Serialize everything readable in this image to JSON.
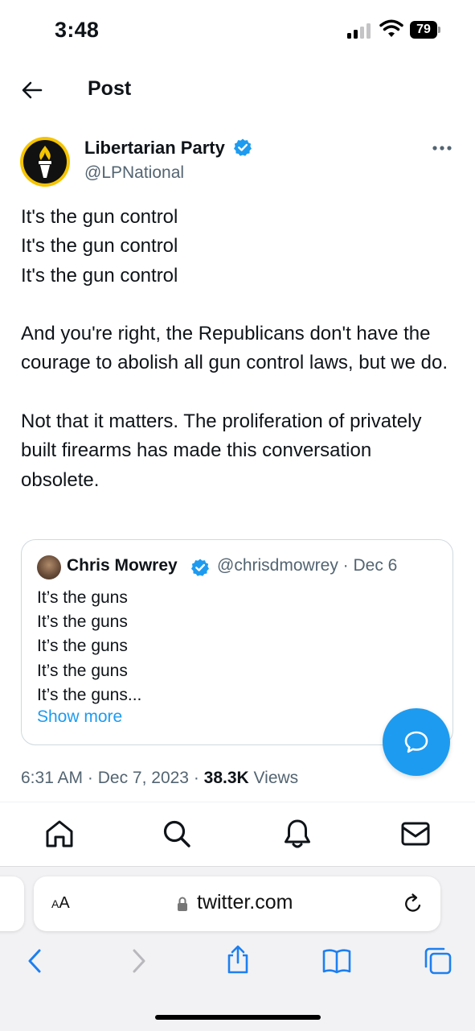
{
  "status_bar": {
    "time": "3:48",
    "battery": "79"
  },
  "header": {
    "title": "Post"
  },
  "post": {
    "author_name": "Libertarian Party",
    "author_handle": "@LPNational",
    "text": "It's the gun control\nIt's the gun control\nIt's the gun control\n\nAnd you're right, the Republicans don't have the courage to abolish all gun control laws, but we do.\n\nNot that it matters. The proliferation of privately built firearms has made this conversation obsolete.",
    "time": "6:31 AM",
    "date": "Dec 7, 2023",
    "views_count": "38.3K",
    "views_label": "Views"
  },
  "quote": {
    "author_name": "Chris Mowrey",
    "author_handle": "@chrisdmowrey · Dec 6",
    "text": "It’s the guns\nIt’s the guns\nIt’s the guns\nIt’s the guns\nIt’s the guns...",
    "show_more": "Show more"
  },
  "browser": {
    "font_size_label_small": "A",
    "font_size_label_large": "A",
    "domain": "twitter.com"
  },
  "colors": {
    "accent": "#1d9bf0",
    "secondary_text": "#536471",
    "avatar_ring": "#f5c400"
  },
  "icons": [
    "back-arrow-icon",
    "verified-badge-icon",
    "more-icon",
    "compose-reply-icon",
    "home-icon",
    "search-icon",
    "notifications-icon",
    "messages-icon",
    "lock-icon",
    "reload-icon",
    "browser-back-icon",
    "browser-forward-icon",
    "share-icon",
    "bookmarks-icon",
    "tabs-icon"
  ]
}
